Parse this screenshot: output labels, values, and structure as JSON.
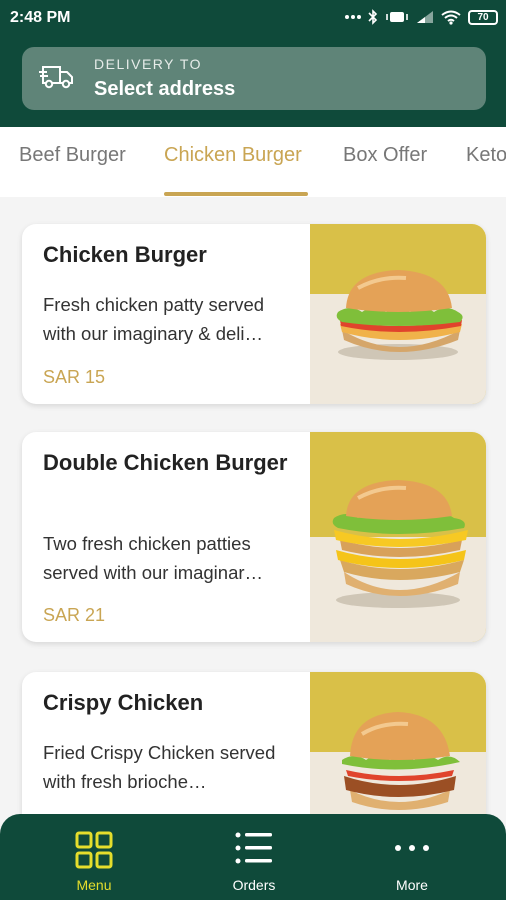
{
  "status_bar": {
    "time": "2:48 PM",
    "battery": "70"
  },
  "delivery": {
    "label": "DELIVERY TO",
    "value": "Select address"
  },
  "tabs": [
    {
      "label": "Beef Burger"
    },
    {
      "label": "Chicken Burger"
    },
    {
      "label": "Box Offer"
    },
    {
      "label": "Keto"
    }
  ],
  "products": [
    {
      "name": "Chicken Burger",
      "description": "Fresh chicken patty served with our imaginary & deli…",
      "price": "SAR 15"
    },
    {
      "name": "Double Chicken Burger",
      "description": "Two fresh chicken patties served with our imaginar…",
      "price": "SAR 21"
    },
    {
      "name": "Crispy Chicken",
      "description": "Fried Crispy Chicken served with fresh brioche…",
      "price": ""
    }
  ],
  "bottom_nav": [
    {
      "label": "Menu",
      "icon": "grid-icon"
    },
    {
      "label": "Orders",
      "icon": "list-icon"
    },
    {
      "label": "More",
      "icon": "more-dots-icon"
    }
  ],
  "colors": {
    "primary": "#0f4a3a",
    "accent": "#c9a553",
    "nav_active": "#e4dd2c"
  }
}
